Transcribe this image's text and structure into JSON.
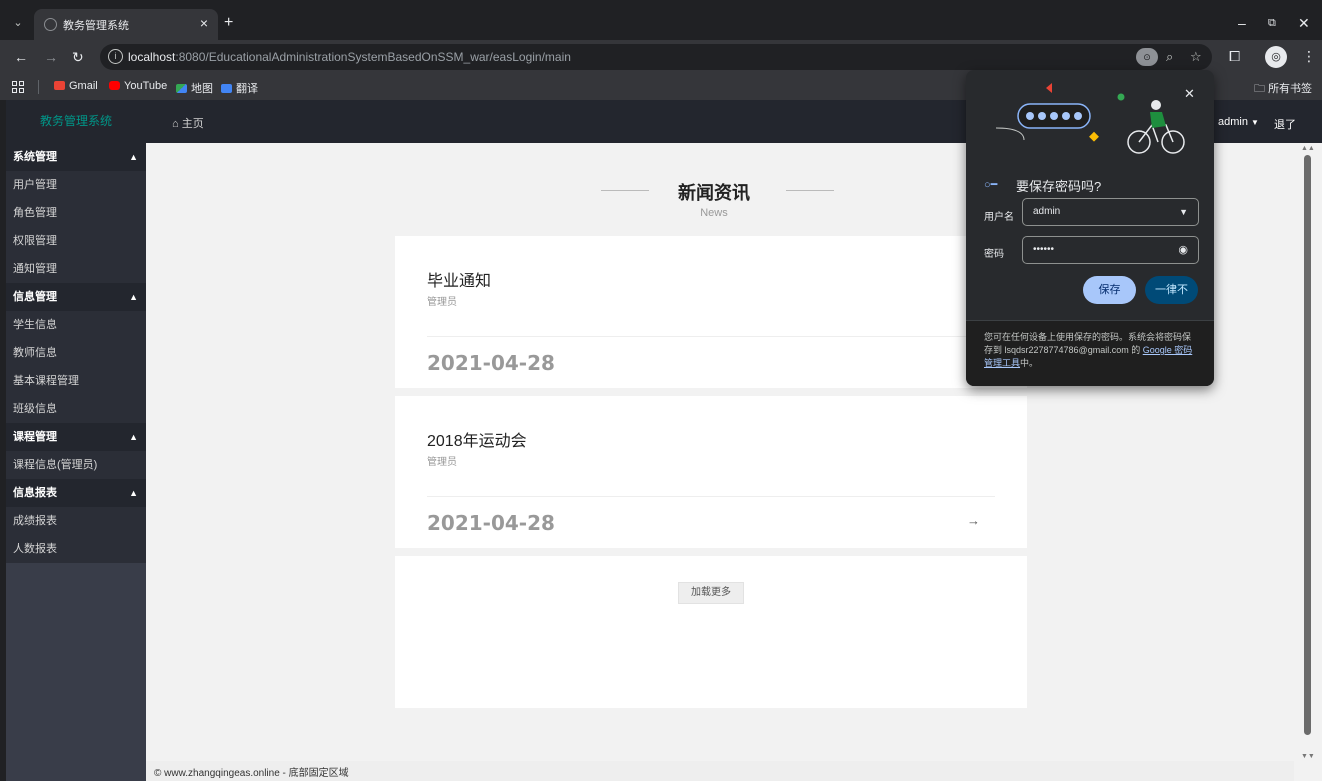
{
  "browser": {
    "tab_title": "教务管理系统",
    "url_host": "localhost",
    "url_rest": ":8080/EducationalAdministrationSystemBasedOnSSM_war/easLogin/main",
    "bookmarks": [
      "Gmail",
      "YouTube",
      "地图",
      "翻译"
    ],
    "all_bookmarks": "所有书签"
  },
  "app": {
    "logo": "教务管理系统",
    "home": "主页",
    "user": "admin",
    "logout": "退了"
  },
  "sidebar": {
    "groups": [
      {
        "label": "系统管理",
        "items": [
          "用户管理",
          "角色管理",
          "权限管理",
          "通知管理"
        ]
      },
      {
        "label": "信息管理",
        "items": [
          "学生信息",
          "教师信息",
          "基本课程管理",
          "班级信息"
        ]
      },
      {
        "label": "课程管理",
        "items": [
          "课程信息(管理员)"
        ]
      },
      {
        "label": "信息报表",
        "items": [
          "成绩报表",
          "人数报表"
        ]
      }
    ]
  },
  "news": {
    "title": "新闻资讯",
    "subtitle": "News",
    "items": [
      {
        "title": "毕业通知",
        "author": "管理员",
        "date": "2021-04-28"
      },
      {
        "title": "2018年运动会",
        "author": "管理员",
        "date": "2021-04-28"
      }
    ],
    "load_more": "加载更多"
  },
  "footer": "© www.zhangqingeas.online - 底部固定区域",
  "password_popup": {
    "heading": "要保存密码吗?",
    "username_label": "用户名",
    "username_value": "admin",
    "password_label": "密码",
    "password_value": "••••••",
    "save": "保存",
    "never": "一律不",
    "footer_text": "您可在任何设备上使用保存的密码。系统会将密码保存到 lsqdsr2278774786@gmail.com 的 ",
    "footer_link": "Google 密码管理工具",
    "footer_end": "中。"
  }
}
